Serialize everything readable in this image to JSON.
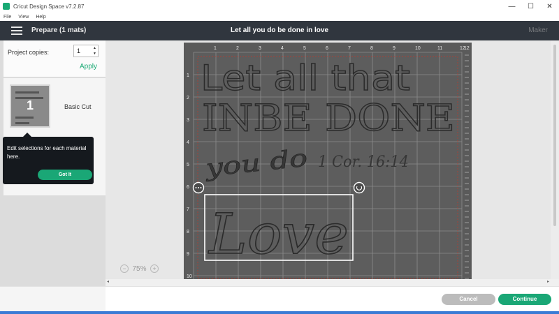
{
  "window": {
    "title": "Cricut Design Space  v7.2.87",
    "controls": {
      "minimize": "—",
      "maximize": "☐",
      "close": "✕"
    }
  },
  "menu": [
    "File",
    "View",
    "Help"
  ],
  "header": {
    "left_title": "Prepare (1 mats)",
    "project_title": "Let all you do be done in love",
    "machine": "Maker"
  },
  "copies": {
    "label": "Project copies:",
    "value": "1",
    "apply": "Apply"
  },
  "mat_list": [
    {
      "number": "1",
      "cut_type": "Basic Cut"
    }
  ],
  "tooltip": {
    "text": "Edit selections for each material here.",
    "button": "Got It"
  },
  "mat": {
    "top_numbers": [
      "1",
      "2",
      "3",
      "4",
      "5",
      "6",
      "7",
      "8",
      "9",
      "10",
      "11",
      "12"
    ],
    "left_numbers": [
      "1",
      "2",
      "3",
      "4",
      "5",
      "6",
      "7",
      "8",
      "9",
      "10"
    ],
    "right_label": "12",
    "design_lines": [
      "Let all that",
      "INBE DONE",
      "you do",
      "1 Cor. 16:14",
      "Love"
    ]
  },
  "zoom": {
    "minus": "−",
    "value": "75%",
    "plus": "+"
  },
  "scroll": {
    "left": "◂",
    "right": "▸"
  },
  "footer": {
    "cancel": "Cancel",
    "continue": "Continue"
  },
  "colors": {
    "accent": "#1aa776",
    "header": "#30363e",
    "mat": "#5a5a5a",
    "design": "#3a3a3a"
  }
}
